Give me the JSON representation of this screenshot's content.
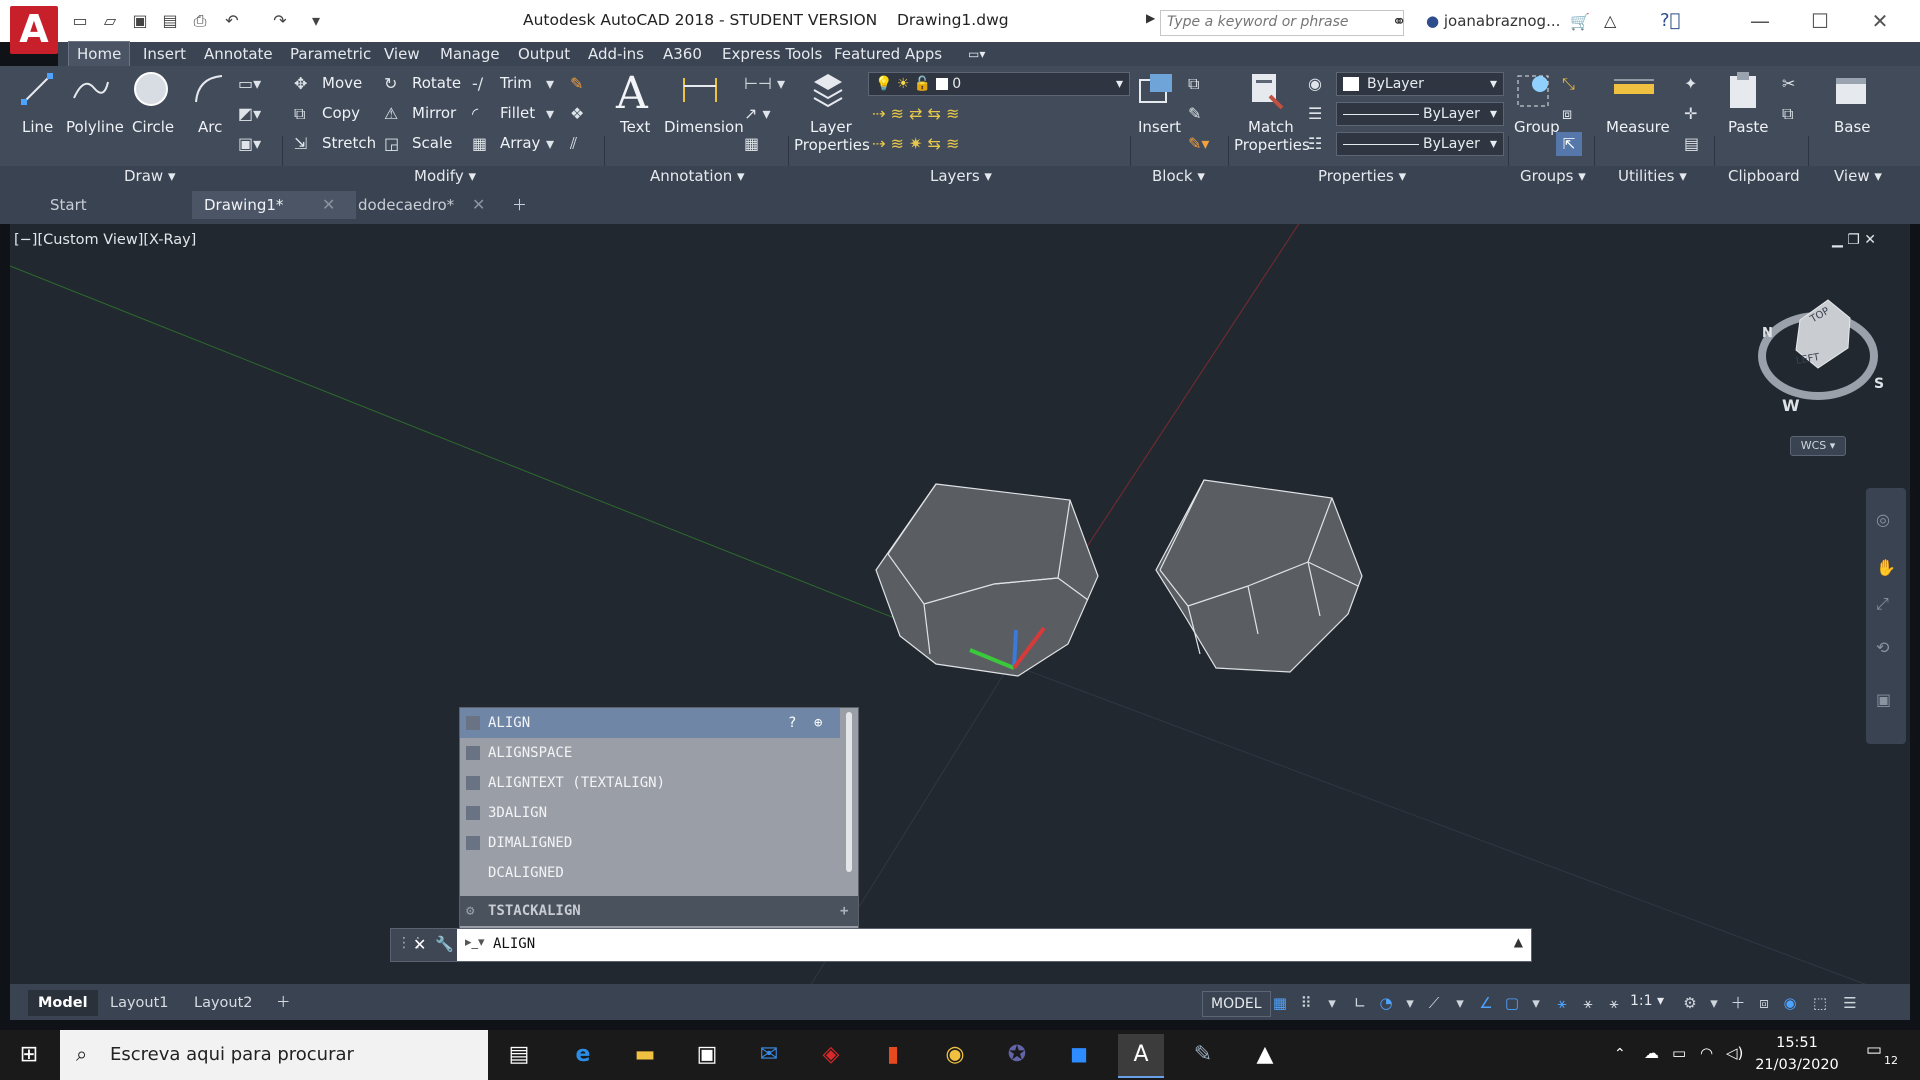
{
  "titlebar": {
    "app_title": "Autodesk AutoCAD 2018 - STUDENT VERSION",
    "file_name": "Drawing1.dwg",
    "search_placeholder": "Type a keyword or phrase",
    "user": "joanabraznog..."
  },
  "ribbon_tabs": [
    "Home",
    "Insert",
    "Annotate",
    "Parametric",
    "View",
    "Manage",
    "Output",
    "Add-ins",
    "A360",
    "Express Tools",
    "Featured Apps"
  ],
  "draw": {
    "line": "Line",
    "polyline": "Polyline",
    "circle": "Circle",
    "arc": "Arc"
  },
  "modify": {
    "move": "Move",
    "copy": "Copy",
    "stretch": "Stretch",
    "rotate": "Rotate",
    "mirror": "Mirror",
    "scale": "Scale",
    "trim": "Trim",
    "fillet": "Fillet",
    "array": "Array"
  },
  "annotation": {
    "text": "Text",
    "dimension": "Dimension"
  },
  "layers": {
    "layer_properties_1": "Layer",
    "layer_properties_2": "Properties",
    "current_layer": "0"
  },
  "block": {
    "insert": "Insert"
  },
  "properties": {
    "match_1": "Match",
    "match_2": "Properties",
    "color": "ByLayer",
    "linetype": "ByLayer",
    "lineweight": "ByLayer"
  },
  "groups": {
    "group": "Group"
  },
  "utilities": {
    "measure": "Measure"
  },
  "clipboard": {
    "paste": "Paste"
  },
  "view": {
    "base": "Base"
  },
  "panels": [
    "Draw",
    "Modify",
    "Annotation",
    "Layers",
    "Block",
    "Properties",
    "Groups",
    "Utilities",
    "Clipboard",
    "View"
  ],
  "doc_tabs": [
    "Start",
    "Drawing1*",
    "dodecaedro*"
  ],
  "viewport_label": "[−][Custom View][X-Ray]",
  "viewcube": {
    "top": "TOP",
    "left": "LEFT",
    "n": "N",
    "w": "W",
    "s": "S",
    "wcs": "WCS"
  },
  "autocomplete": {
    "items": [
      "ALIGN",
      "ALIGNSPACE",
      "ALIGNTEXT (TEXTALIGN)",
      "3DALIGN",
      "DIMALIGNED",
      "DCALIGNED"
    ],
    "footer": "TSTACKALIGN"
  },
  "command_line": {
    "value": "ALIGN"
  },
  "layout_tabs": [
    "Model",
    "Layout1",
    "Layout2"
  ],
  "status": {
    "model": "MODEL",
    "scale": "1:1"
  },
  "taskbar": {
    "search": "Escreva aqui para procurar",
    "time": "15:51",
    "date": "21/03/2020",
    "notifications": "12"
  },
  "colors": {
    "accent_red": "#c8202a",
    "viewport_bg": "#212830",
    "ribbon_bg": "#424b59",
    "selection": "#6f86a6"
  }
}
